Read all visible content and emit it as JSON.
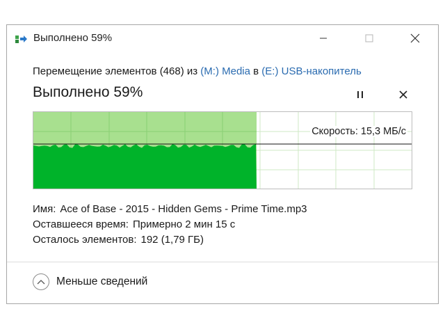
{
  "window": {
    "title": "Выполнено 59%",
    "icons": {
      "app": "file-move-icon",
      "minimize": "minimize-icon",
      "maximize": "maximize-icon",
      "close": "close-icon"
    }
  },
  "operation": {
    "prefix": "Перемещение элементов (468) из ",
    "source": "(M:) Media",
    "middle": " в ",
    "destination": "(E:) USB-накопитель"
  },
  "progress": {
    "headline": "Выполнено 59%",
    "percent": 59,
    "pause_icon": "pause-icon",
    "cancel_icon": "cancel-icon"
  },
  "speed": {
    "label": "Скорость: 15,3 МБ/с",
    "current_line_fraction": 0.58
  },
  "details": {
    "name_label": "Имя:",
    "name_value": "Ace of Base - 2015 - Hidden Gems - Prime Time.mp3",
    "time_label": "Оставшееся время:",
    "time_value": "Примерно 2 мин 15 с",
    "items_label": "Осталось элементов:",
    "items_value": "192 (1,79 ГБ)"
  },
  "footer": {
    "less_label": "Меньше сведений",
    "less_icon": "chevron-up-icon"
  },
  "colors": {
    "graph_fill": "#00b32a",
    "graph_done_bg": "#a8e08f",
    "grid_done": "#89cf73",
    "grid_pending": "#cfe8c6",
    "link": "#2a6bb0"
  }
}
